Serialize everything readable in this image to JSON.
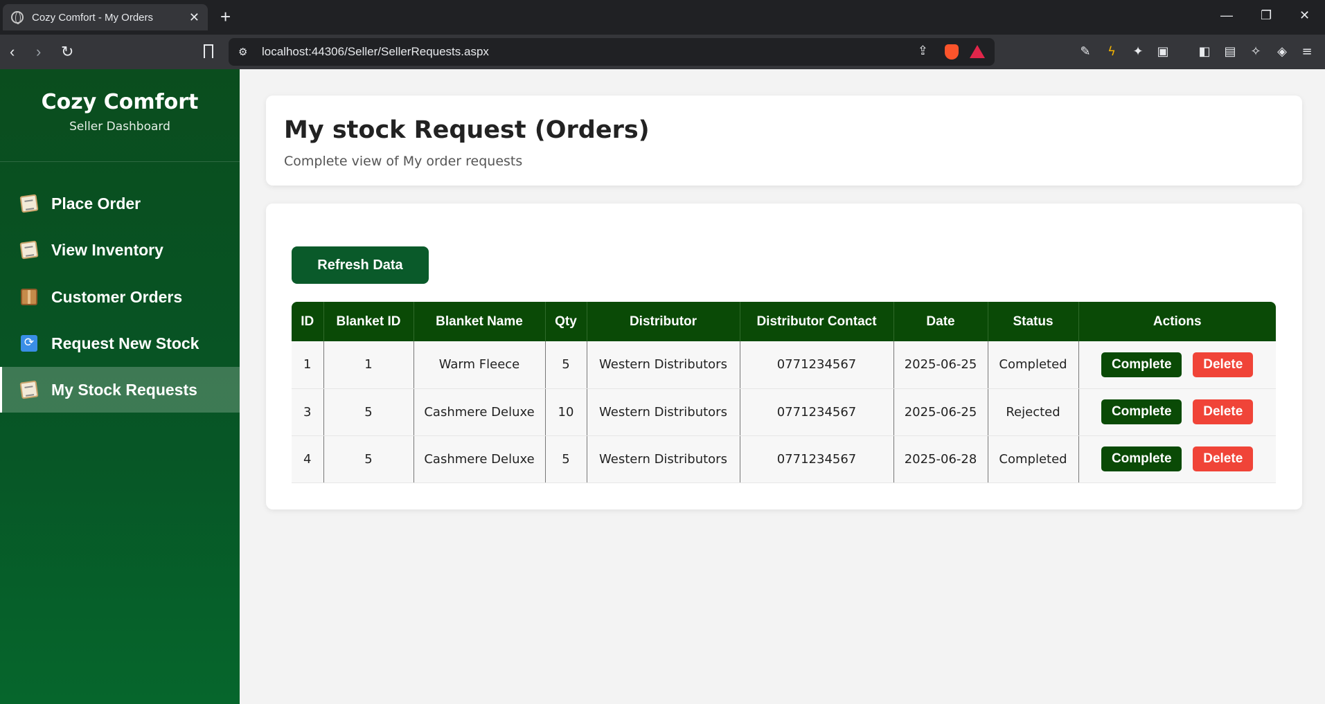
{
  "browser": {
    "tab_title": "Cozy Comfort - My Orders",
    "url": "localhost:44306/Seller/SellerRequests.aspx"
  },
  "sidebar": {
    "brand": "Cozy Comfort",
    "subtitle": "Seller Dashboard",
    "items": [
      {
        "label": "Place Order",
        "icon": "memo-icon"
      },
      {
        "label": "View Inventory",
        "icon": "memo-icon"
      },
      {
        "label": "Customer Orders",
        "icon": "package-icon"
      },
      {
        "label": "Request New Stock",
        "icon": "refresh-icon"
      },
      {
        "label": "My Stock Requests",
        "icon": "memo-icon",
        "active": true
      }
    ]
  },
  "header": {
    "title": "My stock Request (Orders)",
    "subtitle": "Complete view of My order requests"
  },
  "toolbar": {
    "refresh_label": "Refresh Data"
  },
  "table": {
    "columns": [
      "ID",
      "Blanket ID",
      "Blanket Name",
      "Qty",
      "Distributor",
      "Distributor Contact",
      "Date",
      "Status",
      "Actions"
    ],
    "rows": [
      {
        "id": "1",
        "blanket_id": "1",
        "blanket_name": "Warm Fleece",
        "qty": "5",
        "distributor": "Western Distributors",
        "contact": "0771234567",
        "date": "2025-06-25",
        "status": "Completed"
      },
      {
        "id": "3",
        "blanket_id": "5",
        "blanket_name": "Cashmere Deluxe",
        "qty": "10",
        "distributor": "Western Distributors",
        "contact": "0771234567",
        "date": "2025-06-25",
        "status": "Rejected"
      },
      {
        "id": "4",
        "blanket_id": "5",
        "blanket_name": "Cashmere Deluxe",
        "qty": "5",
        "distributor": "Western Distributors",
        "contact": "0771234567",
        "date": "2025-06-28",
        "status": "Completed"
      }
    ],
    "complete_label": "Complete",
    "delete_label": "Delete"
  },
  "colors": {
    "sidebar_bg": "#0a4d1e",
    "header_row": "#0a4a06",
    "delete": "#f04438"
  }
}
